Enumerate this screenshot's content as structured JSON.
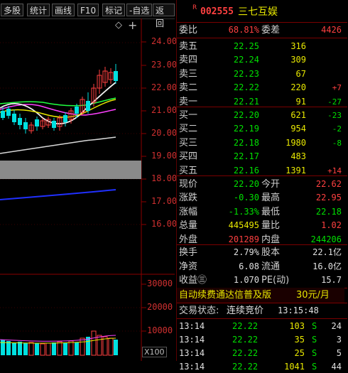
{
  "toolbar": {
    "items": [
      "多股",
      "统计",
      "画线",
      "F10",
      "标记",
      "-自选",
      "返回"
    ]
  },
  "chart": {
    "price_labels": [
      "24.00",
      "23.00",
      "22.00",
      "21.00",
      "20.00",
      "19.00",
      "18.00",
      "17.00",
      "16.00"
    ],
    "volume_labels": [
      "30000",
      "20000",
      "10000"
    ],
    "volume_scale": "X100",
    "diamond": "◇",
    "more": "+"
  },
  "stock": {
    "flag": "R",
    "code": "002555",
    "name": "三七互娱"
  },
  "weibi": {
    "label_ratio": "委比",
    "ratio": "68.81%",
    "label_diff": "委差",
    "diff": "4426"
  },
  "sell": [
    {
      "label": "卖五",
      "price": "22.25",
      "vol": "316",
      "chg": ""
    },
    {
      "label": "卖四",
      "price": "22.24",
      "vol": "309",
      "chg": ""
    },
    {
      "label": "卖三",
      "price": "22.23",
      "vol": "67",
      "chg": ""
    },
    {
      "label": "卖二",
      "price": "22.22",
      "vol": "220",
      "chg": "+7"
    },
    {
      "label": "卖一",
      "price": "22.21",
      "vol": "91",
      "chg": "-27"
    }
  ],
  "buy": [
    {
      "label": "买一",
      "price": "22.20",
      "vol": "621",
      "chg": "-23"
    },
    {
      "label": "买二",
      "price": "22.19",
      "vol": "954",
      "chg": "-2"
    },
    {
      "label": "买三",
      "price": "22.18",
      "vol": "1980",
      "chg": "-8"
    },
    {
      "label": "买四",
      "price": "22.17",
      "vol": "483",
      "chg": ""
    },
    {
      "label": "买五",
      "price": "22.16",
      "vol": "1391",
      "chg": "+14"
    }
  ],
  "quote": [
    {
      "l1": "现价",
      "v1": "22.20",
      "c1": "g",
      "l2": "今开",
      "v2": "22.62",
      "c2": "r"
    },
    {
      "l1": "涨跌",
      "v1": "-0.30",
      "c1": "g",
      "l2": "最高",
      "v2": "22.95",
      "c2": "r"
    },
    {
      "l1": "涨幅",
      "v1": "-1.33%",
      "c1": "g",
      "l2": "最低",
      "v2": "22.18",
      "c2": "g"
    },
    {
      "l1": "总量",
      "v1": "445495",
      "c1": "y",
      "l2": "量比",
      "v2": "1.02",
      "c2": "r"
    },
    {
      "l1": "外盘",
      "v1": "201289",
      "c1": "r",
      "l2": "内盘",
      "v2": "244206",
      "c2": "g"
    }
  ],
  "fin": [
    {
      "l1": "换手",
      "v1": "2.79%",
      "l2": "股本",
      "v2": "22.1亿"
    },
    {
      "l1": "净资",
      "v1": "6.08",
      "l2": "流通",
      "v2": "16.0亿"
    },
    {
      "l1": "收益㊂",
      "v1": "1.070",
      "l2": "PE(动)",
      "v2": "15.7"
    }
  ],
  "ad": {
    "text": "自动续费通达信普及版",
    "price": "30元/月"
  },
  "status": {
    "label": "交易状态:",
    "value": "连续竞价",
    "time": "13:15:48"
  },
  "ticks": [
    {
      "time": "13:14",
      "price": "22.22",
      "vol": "103",
      "side": "S",
      "count": "24"
    },
    {
      "time": "13:14",
      "price": "22.22",
      "vol": "35",
      "side": "S",
      "count": "3"
    },
    {
      "time": "13:14",
      "price": "22.22",
      "vol": "25",
      "side": "S",
      "count": "5"
    },
    {
      "time": "13:14",
      "price": "22.22",
      "vol": "1041",
      "side": "S",
      "count": "44"
    }
  ],
  "colors": {
    "up": "#ff4040",
    "down": "#00e0e0",
    "panel_border": "#7a0000"
  }
}
